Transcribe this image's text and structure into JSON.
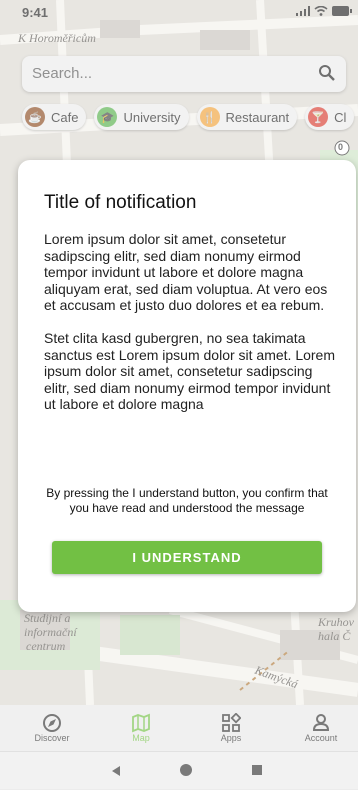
{
  "status": {
    "time": "9:41"
  },
  "map": {
    "labels": [
      "K Horoměřicům",
      "Studijní a",
      "informační",
      "centrum",
      "Kamýcká",
      "Kruhov",
      "hala Č"
    ],
    "badge": "0"
  },
  "search": {
    "placeholder": "Search...",
    "icon": "search-icon"
  },
  "chips": [
    {
      "label": "Cafe",
      "icon": "cafe-icon",
      "color": "#8a4b1f"
    },
    {
      "label": "University",
      "icon": "graduation-cap-icon",
      "color": "#55b04a"
    },
    {
      "label": "Restaurant",
      "icon": "cutlery-icon",
      "color": "#f0a23a"
    },
    {
      "label": "Cl",
      "icon": "cocktail-icon",
      "color": "#d83a2d"
    }
  ],
  "modal": {
    "title": "Title of notification",
    "paragraph1": "Lorem ipsum dolor sit amet, consetetur sadipscing elitr, sed diam nonumy eirmod tempor invidunt ut labore et dolore magna aliquyam erat, sed diam voluptua. At vero eos et accusam et justo duo dolores et ea rebum.",
    "paragraph2": "Stet clita kasd gubergren, no sea takimata sanctus est Lorem ipsum dolor sit amet. Lorem ipsum dolor sit amet, consetetur sadipscing elitr, sed diam nonumy eirmod tempor invidunt ut labore et dolore magna",
    "confirm_text": "By pressing the I understand button, you confirm that you have read and understood the message",
    "button_label": "I UNDERSTAND",
    "accent": "#72c044"
  },
  "tabs": [
    {
      "label": "Discover",
      "icon": "discover-icon",
      "active": false
    },
    {
      "label": "Map",
      "icon": "map-icon",
      "active": true
    },
    {
      "label": "Apps",
      "icon": "apps-icon",
      "active": false
    },
    {
      "label": "Account",
      "icon": "account-icon",
      "active": false
    }
  ]
}
